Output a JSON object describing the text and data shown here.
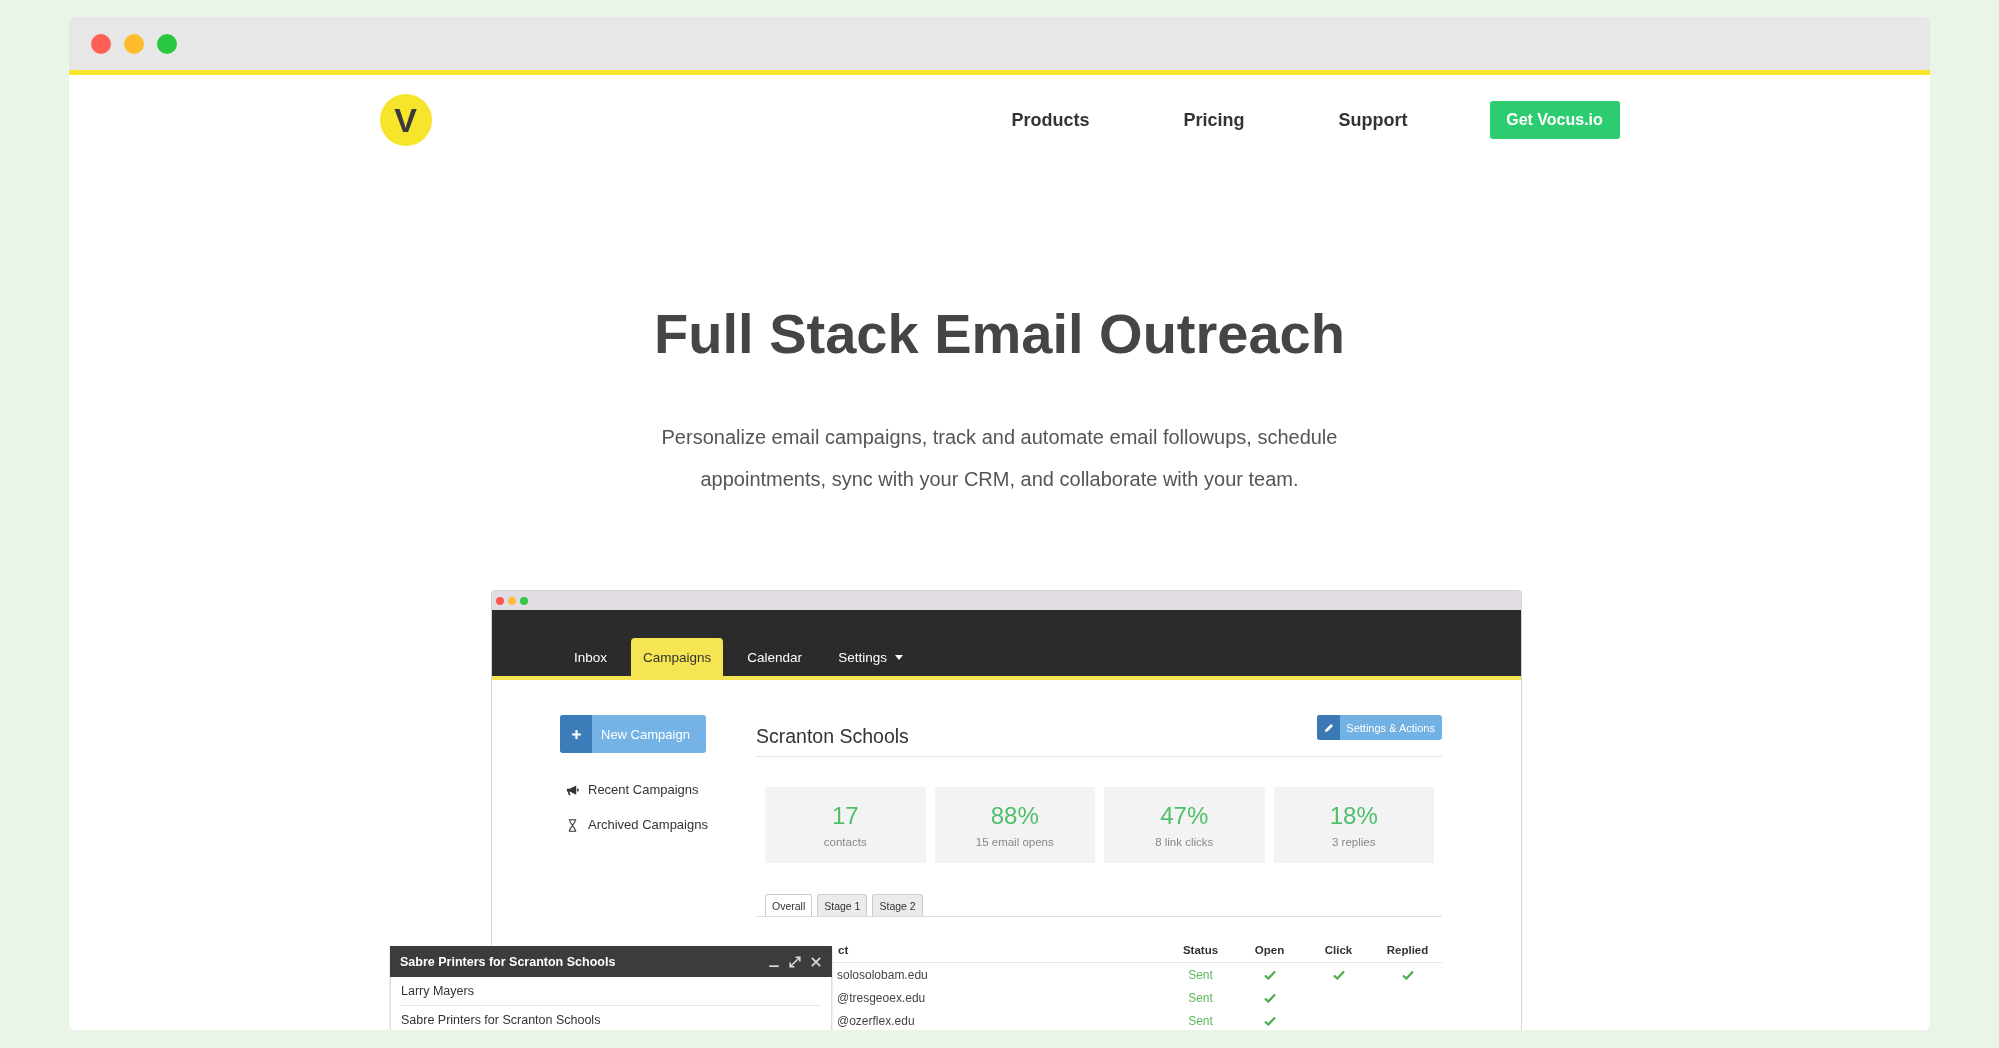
{
  "nav": {
    "logo": "V",
    "links": [
      {
        "label": "Products"
      },
      {
        "label": "Pricing"
      },
      {
        "label": "Support"
      }
    ],
    "cta": "Get Vocus.io"
  },
  "hero": {
    "title": "Full Stack Email Outreach",
    "subtitle": "Personalize email campaigns, track and automate email followups, schedule appointments, sync with your CRM, and collaborate with your team."
  },
  "app_preview": {
    "tabs": [
      {
        "label": "Inbox",
        "kind": "link",
        "selected": false
      },
      {
        "label": "Campaigns",
        "kind": "link",
        "selected": true
      },
      {
        "label": "Calendar",
        "kind": "link",
        "selected": false
      },
      {
        "label": "Settings",
        "kind": "dropdown",
        "selected": false
      }
    ],
    "sidebar": {
      "new_button": "New Campaign",
      "items": [
        {
          "label": "Recent Campaigns",
          "kind": "recent"
        },
        {
          "label": "Archived Campaigns",
          "kind": "archived"
        }
      ]
    },
    "campaign": {
      "title": "Scranton Schools",
      "action_button": "Settings & Actions"
    },
    "stats": [
      {
        "value": "17",
        "label": "contacts"
      },
      {
        "value": "88%",
        "label": "15 email opens"
      },
      {
        "value": "47%",
        "label": "8 link clicks"
      },
      {
        "value": "18%",
        "label": "3 replies"
      }
    ],
    "stage_tabs": [
      {
        "label": "Overall",
        "selected": true
      },
      {
        "label": "Stage 1",
        "selected": false
      },
      {
        "label": "Stage 2",
        "selected": false
      }
    ],
    "table": {
      "columns": [
        "ct",
        "Status",
        "Open",
        "Click",
        "Replied"
      ],
      "rows": [
        {
          "contact": "solosolobam.edu",
          "status": "Sent",
          "opened": true,
          "clicked": true,
          "replied": true
        },
        {
          "contact": "@tresgeoex.edu",
          "status": "Sent",
          "opened": true,
          "clicked": false,
          "replied": false
        },
        {
          "contact": "@ozerflex.edu",
          "status": "Sent",
          "opened": true,
          "clicked": false,
          "replied": false
        }
      ]
    }
  },
  "popup": {
    "title": "Sabre Printers for Scranton Schools",
    "items": [
      "Larry Mayers",
      "Sabre Printers for Scranton Schools"
    ]
  }
}
